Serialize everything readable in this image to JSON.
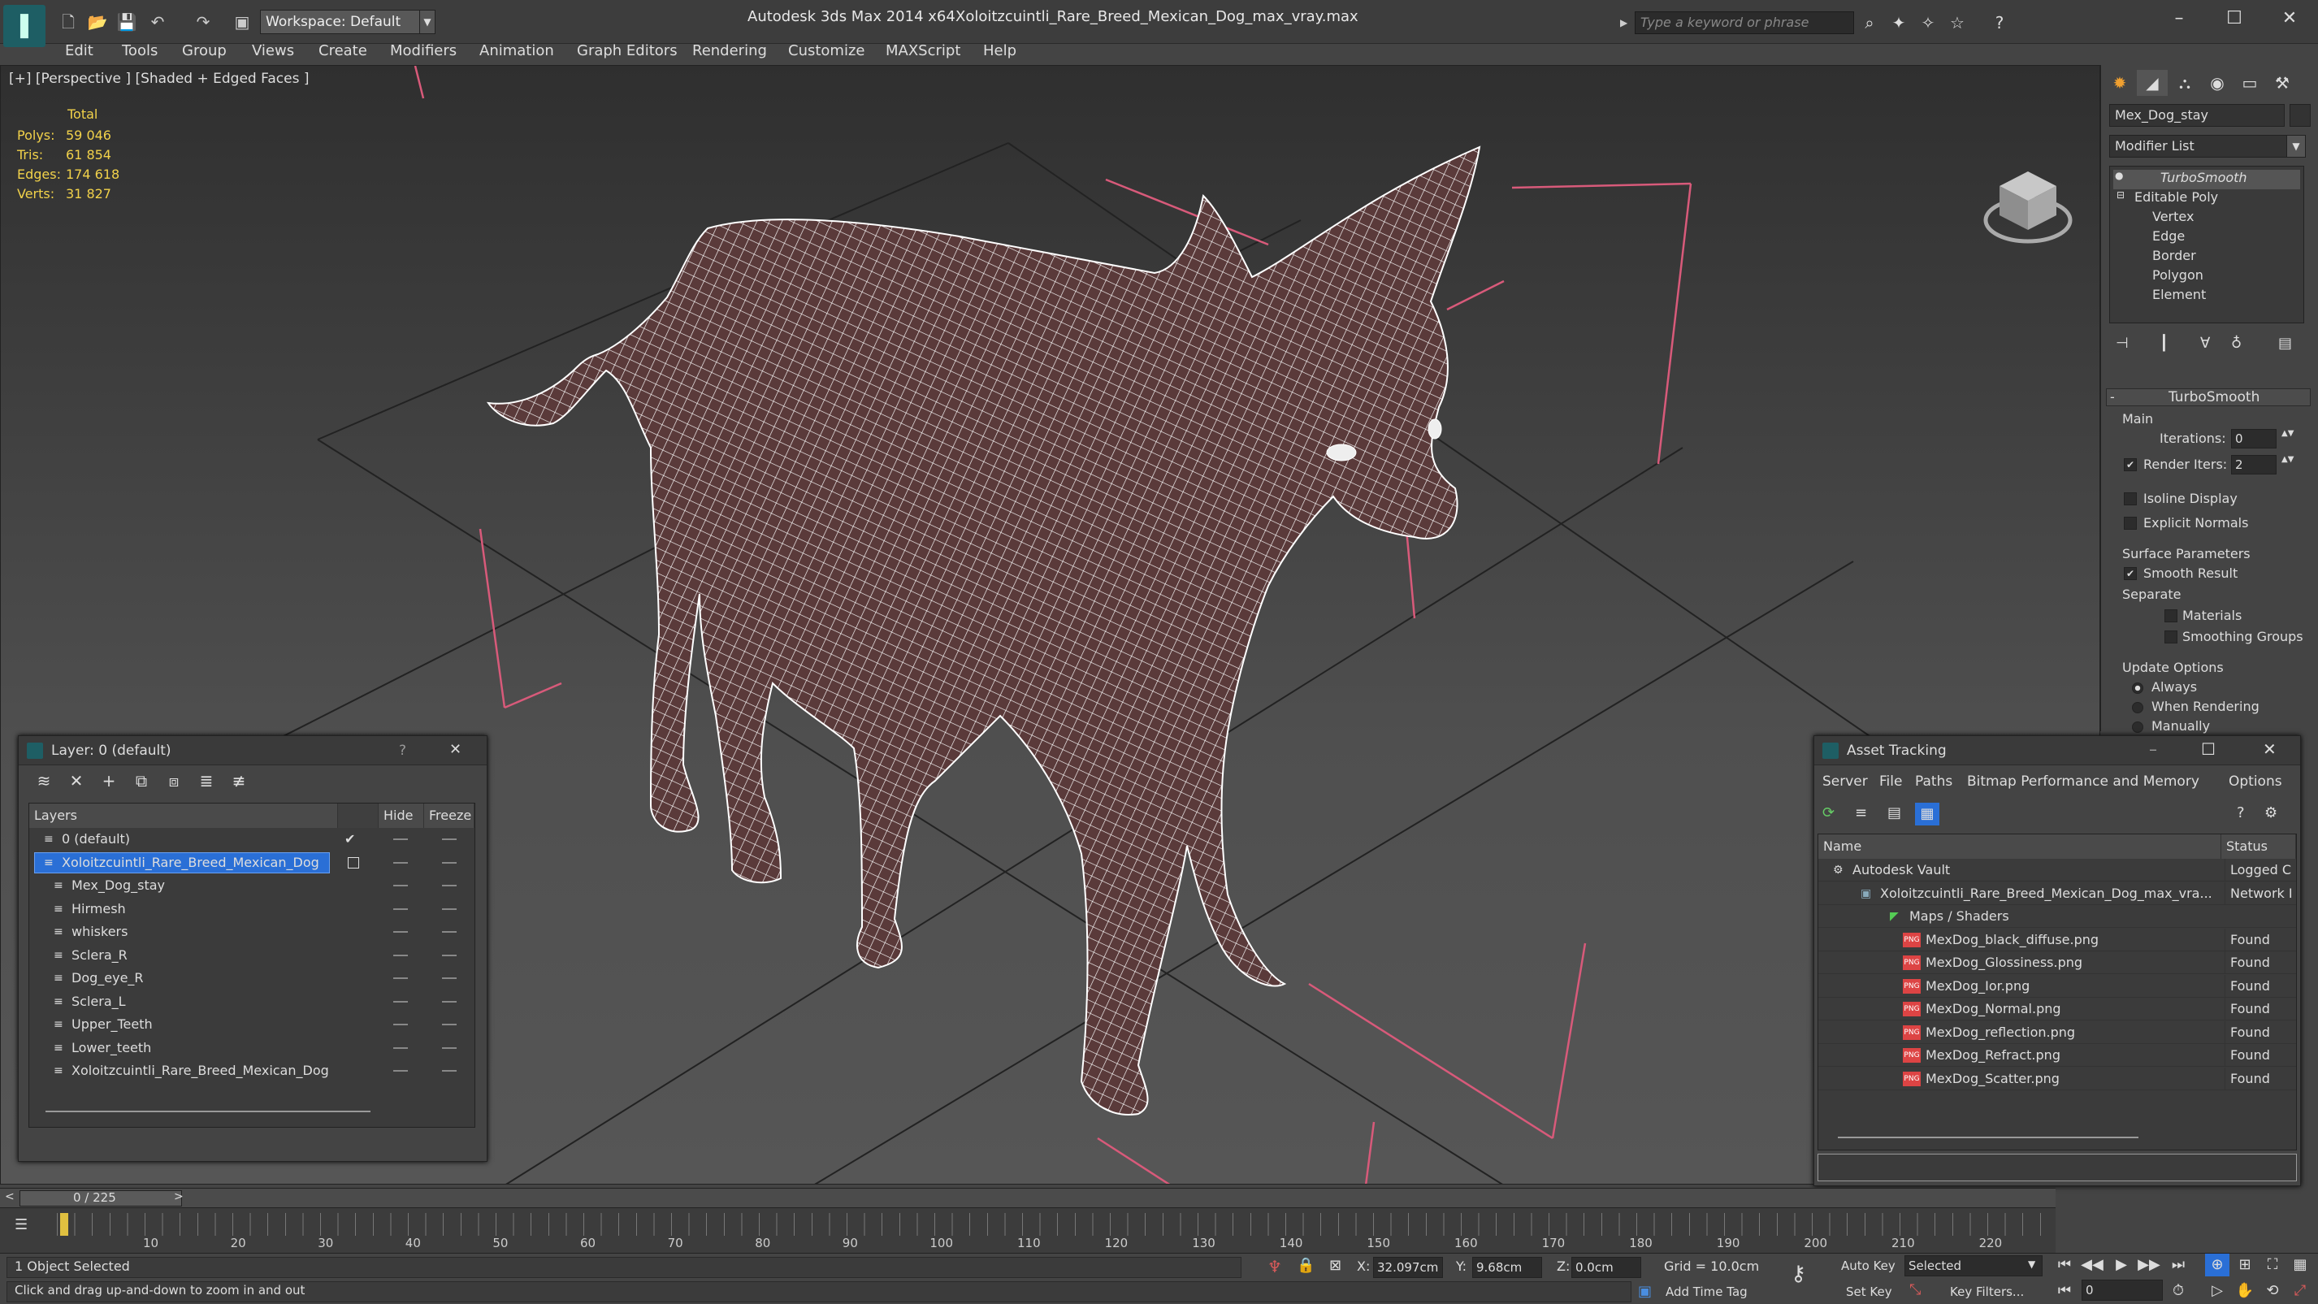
{
  "app": {
    "title": "Autodesk 3ds Max  2014 x64",
    "file": "Xoloitzcuintli_Rare_Breed_Mexican_Dog_max_vray.max",
    "workspace": "Workspace: Default",
    "search_placeholder": "Type a keyword or phrase",
    "logo_icon": "3ds-max-logo-icon"
  },
  "menu": [
    "Edit",
    "Tools",
    "Group",
    "Views",
    "Create",
    "Modifiers",
    "Animation",
    "Graph Editors",
    "Rendering",
    "Customize",
    "MAXScript",
    "Help"
  ],
  "viewport": {
    "label": "[+] [Perspective ] [Shaded + Edged Faces ]",
    "stats_header": "Total",
    "stats": [
      {
        "label": "Polys:",
        "value": "59 046"
      },
      {
        "label": "Tris:",
        "value": "61 854"
      },
      {
        "label": "Edges:",
        "value": "174 618"
      },
      {
        "label": "Verts:",
        "value": "31 827"
      }
    ]
  },
  "command_panel": {
    "object_name": "Mex_Dog_stay",
    "modifier_list": "Modifier List",
    "stack": [
      "TurboSmooth",
      "Editable Poly",
      "Vertex",
      "Edge",
      "Border",
      "Polygon",
      "Element"
    ],
    "rollout": "TurboSmooth",
    "main": "Main",
    "iterations_label": "Iterations:",
    "iterations": "0",
    "render_iters_label": "Render Iters:",
    "render_iters": "2",
    "isoline": "Isoline Display",
    "explicit_normals": "Explicit Normals",
    "surface_params": "Surface Parameters",
    "smooth_result": "Smooth Result",
    "separate": "Separate",
    "materials": "Materials",
    "smoothing_groups": "Smoothing Groups",
    "update_options": "Update Options",
    "always": "Always",
    "when_rendering": "When Rendering",
    "manually": "Manually"
  },
  "layer_window": {
    "title": "Layer: 0 (default)",
    "help": "?",
    "close": "✕",
    "col_layers": "Layers",
    "col_hide": "Hide",
    "col_freeze": "Freeze",
    "rows": [
      {
        "name": "0 (default)",
        "indent": 1
      },
      {
        "name": "Xoloitzcuintli_Rare_Breed_Mexican_Dog",
        "indent": 1,
        "selected": true
      },
      {
        "name": "Mex_Dog_stay",
        "indent": 2
      },
      {
        "name": "Hirmesh",
        "indent": 2
      },
      {
        "name": "whiskers",
        "indent": 2
      },
      {
        "name": "Sclera_R",
        "indent": 2
      },
      {
        "name": "Dog_eye_R",
        "indent": 2
      },
      {
        "name": "Sclera_L",
        "indent": 2
      },
      {
        "name": "Upper_Teeth",
        "indent": 2
      },
      {
        "name": "Lower_teeth",
        "indent": 2
      },
      {
        "name": "Xoloitzcuintli_Rare_Breed_Mexican_Dog",
        "indent": 2
      }
    ]
  },
  "asset_window": {
    "title": "Asset Tracking",
    "menu": [
      "Server",
      "File",
      "Paths",
      "Bitmap Performance and Memory",
      "Options"
    ],
    "col_name": "Name",
    "col_status": "Status",
    "rows": [
      {
        "name": "Autodesk Vault",
        "status": "Logged C",
        "indent": 1
      },
      {
        "name": "Xoloitzcuintli_Rare_Breed_Mexican_Dog_max_vra...",
        "status": "Network I",
        "indent": 2
      },
      {
        "name": "Maps / Shaders",
        "status": "",
        "indent": 3
      },
      {
        "name": "MexDog_black_diffuse.png",
        "status": "Found",
        "indent": 4,
        "png": true
      },
      {
        "name": "MexDog_Glossiness.png",
        "status": "Found",
        "indent": 4,
        "png": true
      },
      {
        "name": "MexDog_Ior.png",
        "status": "Found",
        "indent": 4,
        "png": true
      },
      {
        "name": "MexDog_Normal.png",
        "status": "Found",
        "indent": 4,
        "png": true
      },
      {
        "name": "MexDog_reflection.png",
        "status": "Found",
        "indent": 4,
        "png": true
      },
      {
        "name": "MexDog_Refract.png",
        "status": "Found",
        "indent": 4,
        "png": true
      },
      {
        "name": "MexDog_Scatter.png",
        "status": "Found",
        "indent": 4,
        "png": true
      }
    ]
  },
  "timeline": {
    "frame": "0 / 225",
    "ticks": [
      "10",
      "20",
      "30",
      "40",
      "50",
      "60",
      "70",
      "80",
      "90",
      "100",
      "110",
      "120",
      "130",
      "140",
      "150",
      "160",
      "170",
      "180",
      "190",
      "200",
      "210",
      "220"
    ]
  },
  "status": {
    "selected": "1 Object Selected",
    "hint": "Click and drag up-and-down to zoom in and out",
    "x_label": "X:",
    "x": "32.097cm",
    "y_label": "Y:",
    "y": "9.68cm",
    "z_label": "Z:",
    "z": "0.0cm",
    "grid": "Grid = 10.0cm",
    "add_time_tag": "Add Time Tag",
    "auto_key": "Auto Key",
    "set_key": "Set Key",
    "selected_mode": "Selected",
    "key_filters": "Key Filters...",
    "frame_field": "0"
  },
  "colors": {
    "accent": "#2a6fd6",
    "stats": "#f2d24a",
    "wire": "#ffffff",
    "box": "#d85a7a"
  }
}
